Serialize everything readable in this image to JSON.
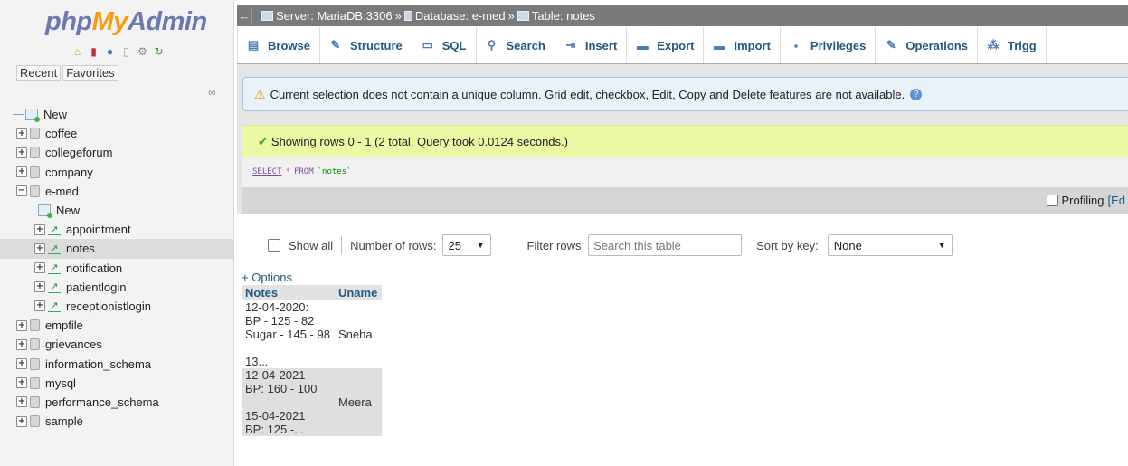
{
  "app": {
    "logo_php": "php",
    "logo_my": "My",
    "logo_admin": "Admin"
  },
  "nav": {
    "recent_label": "Recent",
    "favorites_label": "Favorites",
    "tree": [
      {
        "label": "New",
        "type": "new",
        "level": 0
      },
      {
        "label": "coffee",
        "type": "db",
        "level": 0
      },
      {
        "label": "collegeforum",
        "type": "db",
        "level": 0
      },
      {
        "label": "company",
        "type": "db",
        "level": 0
      },
      {
        "label": "e-med",
        "type": "db-open",
        "level": 0
      },
      {
        "label": "New",
        "type": "new",
        "level": 1
      },
      {
        "label": "appointment",
        "type": "table",
        "level": 1
      },
      {
        "label": "notes",
        "type": "table",
        "level": 1,
        "selected": true
      },
      {
        "label": "notification",
        "type": "table",
        "level": 1
      },
      {
        "label": "patientlogin",
        "type": "table",
        "level": 1
      },
      {
        "label": "receptionistlogin",
        "type": "table",
        "level": 1
      },
      {
        "label": "empfile",
        "type": "db",
        "level": 0
      },
      {
        "label": "grievances",
        "type": "db",
        "level": 0
      },
      {
        "label": "information_schema",
        "type": "db",
        "level": 0
      },
      {
        "label": "mysql",
        "type": "db",
        "level": 0
      },
      {
        "label": "performance_schema",
        "type": "db",
        "level": 0
      },
      {
        "label": "sample",
        "type": "db",
        "level": 0
      }
    ]
  },
  "breadcrumb": {
    "server": "Server: MariaDB:3306",
    "database": "Database: e-med",
    "table": "Table: notes",
    "sep": "»"
  },
  "tabs": [
    {
      "label": "Browse",
      "icon": "browse-icon",
      "glyph": "▤"
    },
    {
      "label": "Structure",
      "icon": "structure-icon",
      "glyph": "✎"
    },
    {
      "label": "SQL",
      "icon": "sql-icon",
      "glyph": "▭"
    },
    {
      "label": "Search",
      "icon": "search-icon",
      "glyph": "⚲"
    },
    {
      "label": "Insert",
      "icon": "insert-icon",
      "glyph": "⇥"
    },
    {
      "label": "Export",
      "icon": "export-icon",
      "glyph": "▬"
    },
    {
      "label": "Import",
      "icon": "import-icon",
      "glyph": "▬"
    },
    {
      "label": "Privileges",
      "icon": "privileges-icon",
      "glyph": "▪"
    },
    {
      "label": "Operations",
      "icon": "operations-icon",
      "glyph": "✎"
    },
    {
      "label": "Trigg",
      "icon": "triggers-icon",
      "glyph": "⁂"
    }
  ],
  "notices": {
    "warning": "Current selection does not contain a unique column. Grid edit, checkbox, Edit, Copy and Delete features are not available.",
    "success": "Showing rows 0 - 1 (2 total, Query took 0.0124 seconds.)"
  },
  "sql": {
    "kw_select": "SELECT",
    "star": "*",
    "kw_from": "FROM",
    "table": "`notes`"
  },
  "profiling": {
    "label": "Profiling",
    "edit_link": "[Ed"
  },
  "navigation": {
    "show_all": "Show all",
    "rows_label": "Number of rows:",
    "rows_value": "25",
    "filter_label": "Filter rows:",
    "filter_placeholder": "Search this table",
    "sort_label": "Sort by key:",
    "sort_value": "None"
  },
  "results": {
    "options_link": "+ Options",
    "columns": [
      "Notes",
      "Uname"
    ],
    "rows": [
      {
        "notes": "12-04-2020:\nBP - 125 - 82\nSugar - 145 - 98\n\n13...",
        "uname": "Sneha"
      },
      {
        "notes": "12-04-2021\nBP: 160 - 100\n\n15-04-2021\nBP: 125 -...",
        "uname": "Meera"
      }
    ]
  },
  "colors": {
    "accent": "#235a81",
    "logo_blue": "#6c78af",
    "logo_orange": "#f89c0e",
    "success_bg": "#ebf8a4",
    "warning_bg": "#e9f1f9"
  }
}
